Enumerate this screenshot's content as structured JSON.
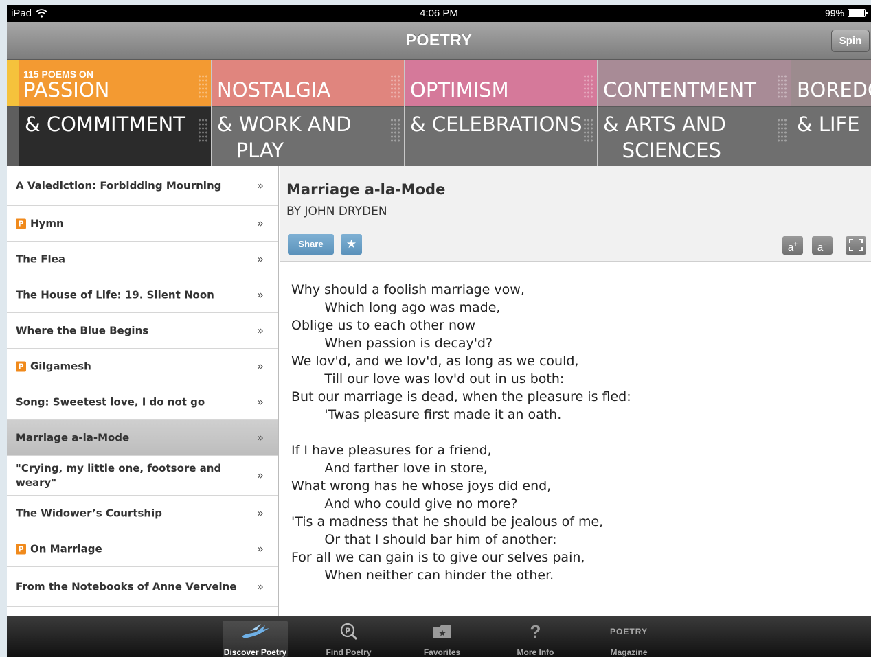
{
  "status_bar": {
    "device": "iPad",
    "time": "4:06 PM",
    "battery": "99%"
  },
  "title_bar": {
    "title": "POETRY",
    "spin_label": "Spin"
  },
  "slots": [
    {
      "prefix": "115 POEMS ON",
      "top": "PASSION",
      "bottom": "& COMMITMENT",
      "color": "#f39a32"
    },
    {
      "prefix": "",
      "top": "NOSTALGIA",
      "bottom": "& WORK AND\n   PLAY",
      "color": "#e0857e"
    },
    {
      "prefix": "",
      "top": "OPTIMISM",
      "bottom": "& CELEBRATIONS",
      "color": "#d5799a"
    },
    {
      "prefix": "",
      "top": "CONTENTMENT",
      "bottom": "& ARTS AND\n   SCIENCES",
      "color": "#a88b96"
    },
    {
      "prefix": "",
      "top": "BOREDC",
      "bottom": "& LIFE",
      "color": "#9c8b8e"
    }
  ],
  "poem_list": [
    {
      "title": "A Valediction:  Forbidding Mourning",
      "badge": false,
      "selected": false
    },
    {
      "title": "Hymn",
      "badge": true,
      "selected": false
    },
    {
      "title": "The Flea",
      "badge": false,
      "selected": false
    },
    {
      "title": "The House of Life: 19. Silent Noon",
      "badge": false,
      "selected": false
    },
    {
      "title": "Where the Blue Begins",
      "badge": false,
      "selected": false
    },
    {
      "title": "Gilgamesh",
      "badge": true,
      "selected": false
    },
    {
      "title": "Song: Sweetest love, I do not go",
      "badge": false,
      "selected": false
    },
    {
      "title": "Marriage a-la-Mode",
      "badge": false,
      "selected": true
    },
    {
      "title": "\"Crying, my little one, footsore and weary\"",
      "badge": false,
      "selected": false
    },
    {
      "title": "The Widower’s Courtship",
      "badge": false,
      "selected": false
    },
    {
      "title": "On Marriage",
      "badge": true,
      "selected": false
    },
    {
      "title": "From the Notebooks of Anne Verveine",
      "badge": false,
      "selected": false
    }
  ],
  "list_chevron": "»",
  "badge_letter": "P",
  "poem": {
    "title": "Marriage a-la-Mode",
    "by_prefix": "BY ",
    "author": "JOHN DRYDEN",
    "share_label": "Share",
    "star_icon": "star-icon",
    "lines": [
      "Why should a foolish marriage vow,",
      "        Which long ago was made,",
      "Oblige us to each other now",
      "        When passion is decay'd?",
      "We lov'd, and we lov'd, as long as we could,",
      "        Till our love was lov'd out in us both:",
      "But our marriage is dead, when the pleasure is fled:",
      "        'Twas pleasure first made it an oath.",
      "",
      "If I have pleasures for a friend,",
      "        And farther love in store,",
      "What wrong has he whose joys did end,",
      "        And who could give no more?",
      "'Tis a madness that he should be jealous of me,",
      "        Or that I should bar him of another:",
      "For all we can gain is to give our selves pain,",
      "        When neither can hinder the other."
    ]
  },
  "tabs": [
    {
      "label": "Discover Poetry",
      "icon": "pegasus-icon",
      "active": true
    },
    {
      "label": "Find Poetry",
      "icon": "magnifier-icon",
      "active": false
    },
    {
      "label": "Favorites",
      "icon": "favorites-folder-icon",
      "active": false
    },
    {
      "label": "More Info",
      "icon": "question-icon",
      "active": false
    },
    {
      "label": "Magazine",
      "icon": "poetry-magazine-icon",
      "active": false,
      "icon_text": "POETRY"
    }
  ]
}
